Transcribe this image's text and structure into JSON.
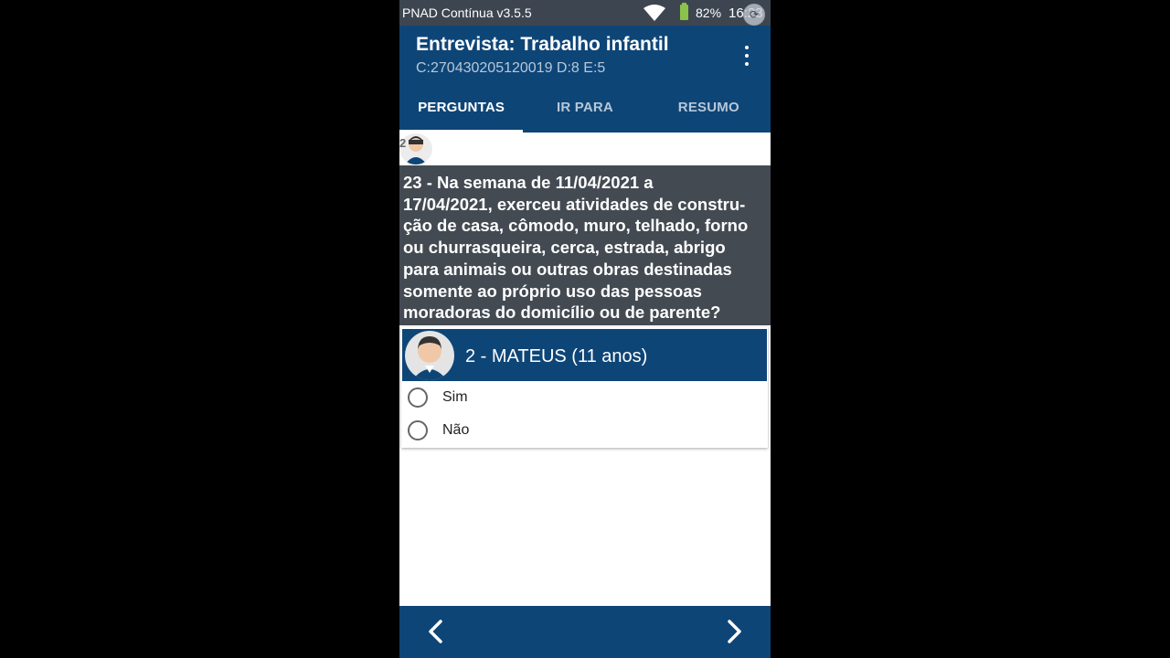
{
  "status_bar": {
    "app_name": "PNAD Contínua v3.5.5",
    "battery": "82%",
    "time": "16:23"
  },
  "app_bar": {
    "title": "Entrevista: Trabalho infantil",
    "subtitle": "C:270430205120019 D:8 E:5"
  },
  "tabs": [
    {
      "label": "PERGUNTAS",
      "active": true
    },
    {
      "label": "IR PARA",
      "active": false
    },
    {
      "label": "RESUMO",
      "active": false
    }
  ],
  "person_strip": {
    "number": "2"
  },
  "question": {
    "lines": [
      "23 - Na semana de 11/04/2021 a",
      "17/04/2021, exerceu atividades de constru-",
      "ção de casa, cômodo, muro, telhado, forno",
      "ou churrasqueira, cerca, estrada, abrigo",
      "para animais ou outras obras destinadas",
      "somente ao próprio uso das pessoas",
      "moradoras do domicílio ou de parente?"
    ]
  },
  "respondent": {
    "name": "2 - MATEUS (11 anos)"
  },
  "options": [
    "Sim",
    "Não"
  ],
  "colors": {
    "primary": "#0e4577",
    "status_bar": "#3d4650",
    "question_bg": "#434a52"
  }
}
